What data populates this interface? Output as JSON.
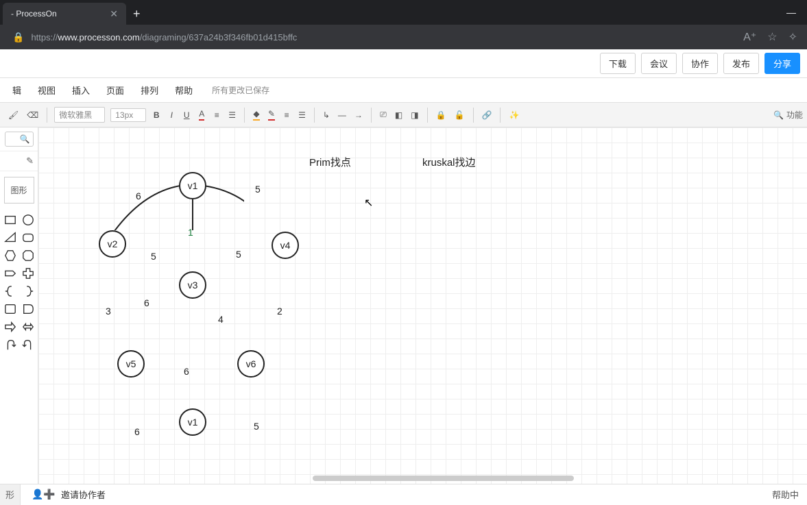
{
  "browser": {
    "tab_title": "- ProcessOn",
    "url_host": "www.processon.com",
    "url_path": "/diagraming/637a24b3f346fb01d415bffc"
  },
  "header_buttons": {
    "download": "下载",
    "meeting": "会议",
    "collab": "协作",
    "publish": "发布",
    "share": "分享"
  },
  "menubar": {
    "edit": "辑",
    "view": "视图",
    "insert": "插入",
    "page": "页面",
    "arrange": "排列",
    "help": "帮助",
    "save_status": "所有更改已保存"
  },
  "format": {
    "font_name": "微软雅黑",
    "font_size": "13px",
    "search_label": "功能"
  },
  "sidebar": {
    "shapes_label": "图形",
    "shapes_handle": "形"
  },
  "canvas": {
    "labels": {
      "prim": "Prim找点",
      "kruskal": "kruskal找边"
    },
    "nodes": {
      "v1": "v1",
      "v2": "v2",
      "v3": "v3",
      "v4": "v4",
      "v5": "v5",
      "v6": "v6",
      "v1b": "v1"
    },
    "weights": {
      "v1v2": "6",
      "v1v4": "5",
      "v1v3": "1",
      "v2v3": "5",
      "v3v4": "5",
      "v2v5": "3",
      "v3v5": "6",
      "v3v6": "4",
      "v4v6": "2",
      "v5v6": "6",
      "b_left": "6",
      "b_right": "5"
    }
  },
  "footer": {
    "invite": "邀请协作者",
    "help": "帮助中"
  }
}
